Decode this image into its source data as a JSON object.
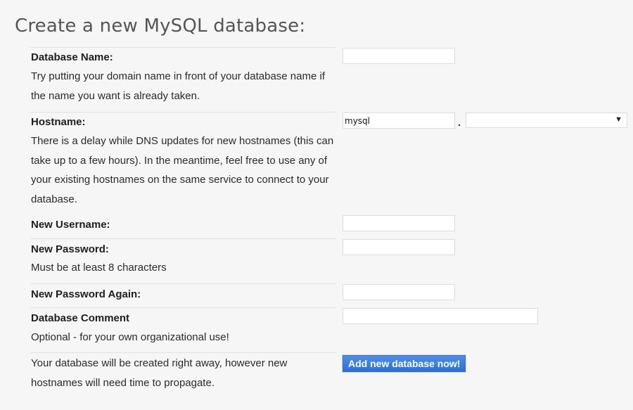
{
  "title": "Create a new MySQL database:",
  "database_name": {
    "label": "Database Name:",
    "description": "Try putting your domain name in front of your database name if the name you want is already taken.",
    "value": ""
  },
  "hostname": {
    "label": "Hostname:",
    "description": "There is a delay while DNS updates for new hostnames (this can take up to a few hours). In the meantime, feel free to use any of your existing hostnames on the same service to connect to your database.",
    "value": "mysql",
    "separator": ".",
    "domain_selected": ""
  },
  "new_username": {
    "label": "New Username:",
    "value": ""
  },
  "new_password": {
    "label": "New Password:",
    "description": "Must be at least 8 characters",
    "value": ""
  },
  "new_password_again": {
    "label": "New Password Again:",
    "value": ""
  },
  "database_comment": {
    "label": "Database Comment",
    "description": "Optional - for your own organizational use!",
    "value": ""
  },
  "footer_note": "Your database will be created right away, however new hostnames will need time to propagate.",
  "submit_label": "Add new database now!",
  "icons": {
    "dropdown": "chevron-down-icon"
  }
}
